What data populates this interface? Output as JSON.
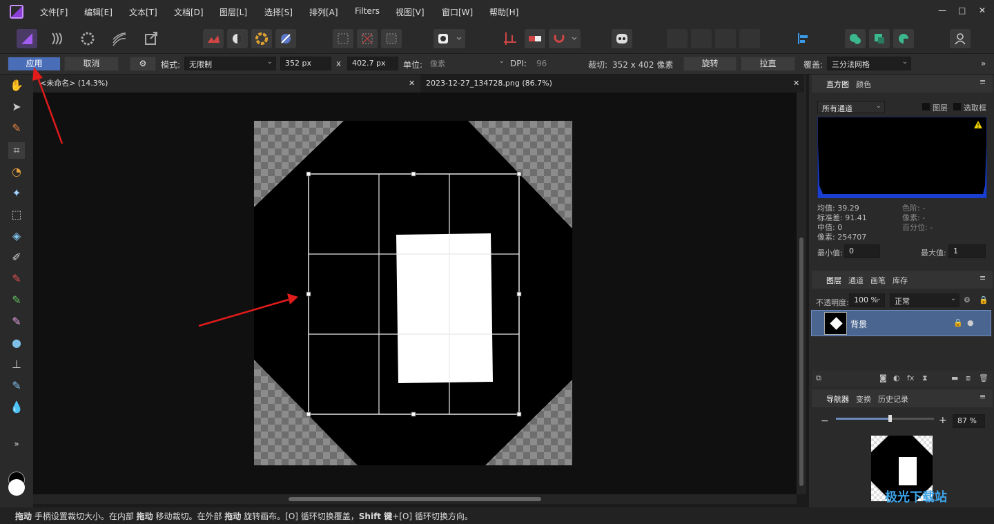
{
  "menu": [
    "文件[F]",
    "编辑[E]",
    "文本[T]",
    "文档[D]",
    "图层[L]",
    "选择[S]",
    "排列[A]",
    "Filters",
    "视图[V]",
    "窗口[W]",
    "帮助[H]"
  ],
  "window_controls": [
    "—",
    "□",
    "✕"
  ],
  "context": {
    "apply_label": "应用",
    "cancel_label": "取消",
    "mode_label": "模式:",
    "mode_value": "无限制",
    "width_value": "352 px",
    "x_label": "x",
    "height_value": "402.7 px",
    "unit_label": "单位:",
    "unit_value": "像素",
    "dpi_label": "DPI:",
    "dpi_value": "96",
    "crop_label": "裁切:",
    "crop_value": "352 x 402 像素",
    "rotate_label": "旋转",
    "straighten_label": "拉直",
    "overlay_label": "覆盖:",
    "overlay_value": "三分法网格",
    "more": "»"
  },
  "tabs": [
    {
      "label": "<未命名> (14.3%)",
      "close": "✕"
    },
    {
      "label": "2023-12-27_134728.png (86.7%)",
      "close": "✕"
    }
  ],
  "histogram": {
    "tab1": "直方图",
    "tab2": "颜色",
    "channel": "所有通道",
    "layer_label": "图层",
    "selection_label": "选取框",
    "mean": "均值: 39.29",
    "std": "标准差: 91.41",
    "median": "中值: 0",
    "pixels": "像素: 254707",
    "levels": "色阶: -",
    "pixel_count": "像素: -",
    "percentile": "百分位: -",
    "min_label": "最小值:",
    "min_value": "0",
    "max_label": "最大值:",
    "max_value": "1"
  },
  "layers": {
    "tabs": [
      "图层",
      "通道",
      "画笔",
      "库存"
    ],
    "opacity_label": "不透明度:",
    "opacity_value": "100 %",
    "blend": "正常",
    "layer_name": "背景"
  },
  "navigator": {
    "tabs": [
      "导航器",
      "变换",
      "历史记录"
    ],
    "zoom": "87 %",
    "zoom_level": 0.55
  },
  "status": {
    "b1": "拖动",
    "t1": " 手柄设置裁切大小。在内部 ",
    "b2": "拖动",
    "t2": " 移动裁切。在外部 ",
    "b3": "拖动",
    "t3": " 旋转画布。[O] 循环切换覆盖，",
    "b4": "Shift 键",
    "t4": "+[O] 循环切换方向。"
  },
  "watermark": "极光下载站",
  "colors": {
    "accent": "#4a6db8",
    "affinity": "#8b3fd6",
    "arrow": "#e21b1b"
  }
}
